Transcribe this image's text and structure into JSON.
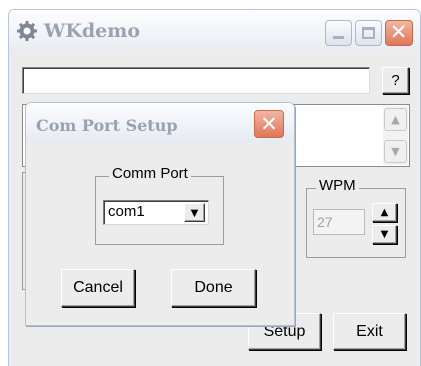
{
  "main_window": {
    "title": "WKdemo",
    "help_label": "?",
    "wpm": {
      "label": "WPM",
      "value": "27"
    },
    "setup_label": "Setup",
    "exit_label": "Exit"
  },
  "dialog": {
    "title": "Com Port Setup",
    "comm_port_label": "Comm Port",
    "comm_port_value": "com1",
    "cancel_label": "Cancel",
    "done_label": "Done"
  },
  "icons": {
    "close": "✕",
    "up": "▲",
    "down": "▼"
  },
  "colors": {
    "title_text": "#9aa3b1",
    "close_button": "#e07757",
    "window_background": "#ececec"
  }
}
